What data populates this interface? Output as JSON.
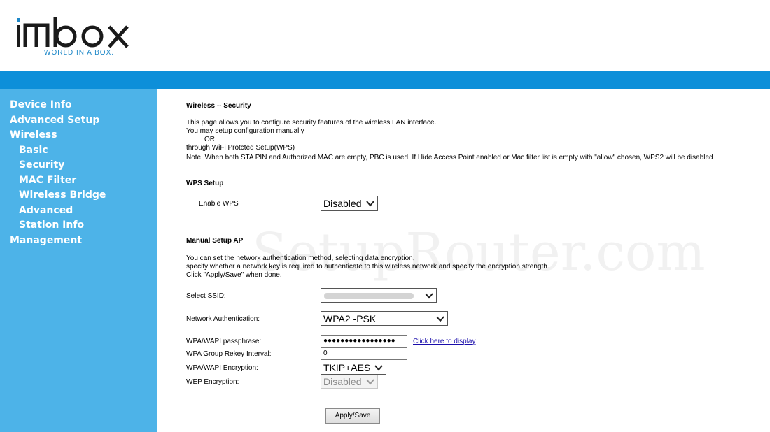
{
  "brand": {
    "name": "IMBOX",
    "tagline": "WORLD IN A BOX."
  },
  "colors": {
    "band": "#0d8fd9",
    "sidebar": "#4db3e8",
    "logo_dark": "#1a1a1a",
    "logo_blue": "#1e88c8"
  },
  "sidebar": {
    "items": [
      {
        "label": "Device Info",
        "level": 0
      },
      {
        "label": "Advanced Setup",
        "level": 0
      },
      {
        "label": "Wireless",
        "level": 0
      },
      {
        "label": "Basic",
        "level": 1
      },
      {
        "label": "Security",
        "level": 1
      },
      {
        "label": "MAC Filter",
        "level": 1
      },
      {
        "label": "Wireless Bridge",
        "level": 1
      },
      {
        "label": "Advanced",
        "level": 1
      },
      {
        "label": "Station Info",
        "level": 1
      },
      {
        "label": "Management",
        "level": 0
      }
    ]
  },
  "page": {
    "title": "Wireless -- Security",
    "intro": [
      "This page allows you to configure security features of the wireless LAN interface.",
      "You may setup configuration manually",
      "OR",
      "through WiFi Protcted Setup(WPS)",
      "Note: When both STA PIN and Authorized MAC are empty, PBC is used. If Hide Access Point enabled or Mac filter list is empty with \"allow\" chosen, WPS2 will be disabled"
    ]
  },
  "wps": {
    "title": "WPS Setup",
    "enable_label": "Enable WPS",
    "enable_value": "Disabled"
  },
  "manual": {
    "title": "Manual Setup AP",
    "desc": [
      "You can set the network authentication method, selecting data encryption,",
      "specify whether a network key is required to authenticate to this wireless network and specify the encryption strength.",
      "Click \"Apply/Save\" when done."
    ],
    "ssid_label": "Select SSID:",
    "auth_label": "Network Authentication:",
    "auth_value": "WPA2 -PSK",
    "passphrase_label": "WPA/WAPI passphrase:",
    "passphrase_value": "●●●●●●●●●●●●●●●●●",
    "show_link": "Click here to display",
    "rekey_label": "WPA Group Rekey Interval:",
    "rekey_value": "0",
    "encryption_label": "WPA/WAPI Encryption:",
    "encryption_value": "TKIP+AES",
    "wep_label": "WEP Encryption:",
    "wep_value": "Disabled",
    "apply_label": "Apply/Save"
  },
  "watermark": "SetupRouter.com"
}
